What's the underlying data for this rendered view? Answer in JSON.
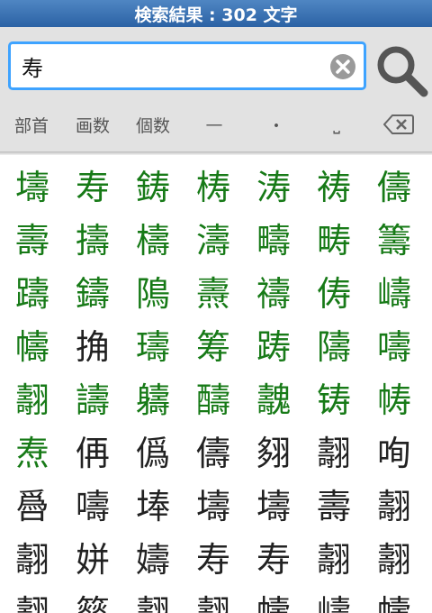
{
  "title": "検索結果 : 302 文字",
  "search": {
    "value": "寿"
  },
  "toolbar": {
    "radical": "部首",
    "strokes": "画数",
    "count": "個数",
    "dash": "—",
    "dot": "・",
    "space": "⎵"
  },
  "colors": {
    "green": "#177a17",
    "black": "#222222",
    "accent": "#3ea3ff"
  },
  "kanji": [
    {
      "c": "壔",
      "g": true
    },
    {
      "c": "寿",
      "g": true
    },
    {
      "c": "鋳",
      "g": true
    },
    {
      "c": "梼",
      "g": true
    },
    {
      "c": "涛",
      "g": true
    },
    {
      "c": "祷",
      "g": true
    },
    {
      "c": "儔",
      "g": true
    },
    {
      "c": "壽",
      "g": true
    },
    {
      "c": "擣",
      "g": true
    },
    {
      "c": "檮",
      "g": true
    },
    {
      "c": "濤",
      "g": true
    },
    {
      "c": "疇",
      "g": true
    },
    {
      "c": "畴",
      "g": true
    },
    {
      "c": "籌",
      "g": true
    },
    {
      "c": "躊",
      "g": true
    },
    {
      "c": "鑄",
      "g": true
    },
    {
      "c": "隝",
      "g": true
    },
    {
      "c": "燾",
      "g": true
    },
    {
      "c": "禱",
      "g": true
    },
    {
      "c": "俦",
      "g": true
    },
    {
      "c": "嶹",
      "g": true
    },
    {
      "c": "幬",
      "g": true
    },
    {
      "c": "捔",
      "g": false
    },
    {
      "c": "璹",
      "g": true
    },
    {
      "c": "筹",
      "g": true
    },
    {
      "c": "踌",
      "g": true
    },
    {
      "c": "隯",
      "g": true
    },
    {
      "c": "嚋",
      "g": true
    },
    {
      "c": "翿",
      "g": true
    },
    {
      "c": "譸",
      "g": true
    },
    {
      "c": "軇",
      "g": true
    },
    {
      "c": "醻",
      "g": true
    },
    {
      "c": "魗",
      "g": true
    },
    {
      "c": "铸",
      "g": true
    },
    {
      "c": "帱",
      "g": true
    },
    {
      "c": "焘",
      "g": true
    },
    {
      "c": "侢",
      "g": false
    },
    {
      "c": "僞",
      "g": false
    },
    {
      "c": "儔",
      "g": false
    },
    {
      "c": "翗",
      "g": false
    },
    {
      "c": "翿",
      "g": false
    },
    {
      "c": "咰",
      "g": false
    },
    {
      "c": "噕",
      "g": false
    },
    {
      "c": "嚋",
      "g": false
    },
    {
      "c": "埲",
      "g": false
    },
    {
      "c": "壔",
      "g": false
    },
    {
      "c": "壔",
      "g": false
    },
    {
      "c": "壽",
      "g": false
    },
    {
      "c": "翿",
      "g": false
    },
    {
      "c": "翿",
      "g": false
    },
    {
      "c": "姘",
      "g": false
    },
    {
      "c": "嬦",
      "g": false
    },
    {
      "c": "寿",
      "g": false
    },
    {
      "c": "寿",
      "g": false
    },
    {
      "c": "翿",
      "g": false
    },
    {
      "c": "翿",
      "g": false
    },
    {
      "c": "翿",
      "g": false
    },
    {
      "c": "簩",
      "g": false
    },
    {
      "c": "翿",
      "g": false
    },
    {
      "c": "翿",
      "g": false
    },
    {
      "c": "幬",
      "g": false
    },
    {
      "c": "嶹",
      "g": false
    },
    {
      "c": "幬",
      "g": false
    }
  ]
}
